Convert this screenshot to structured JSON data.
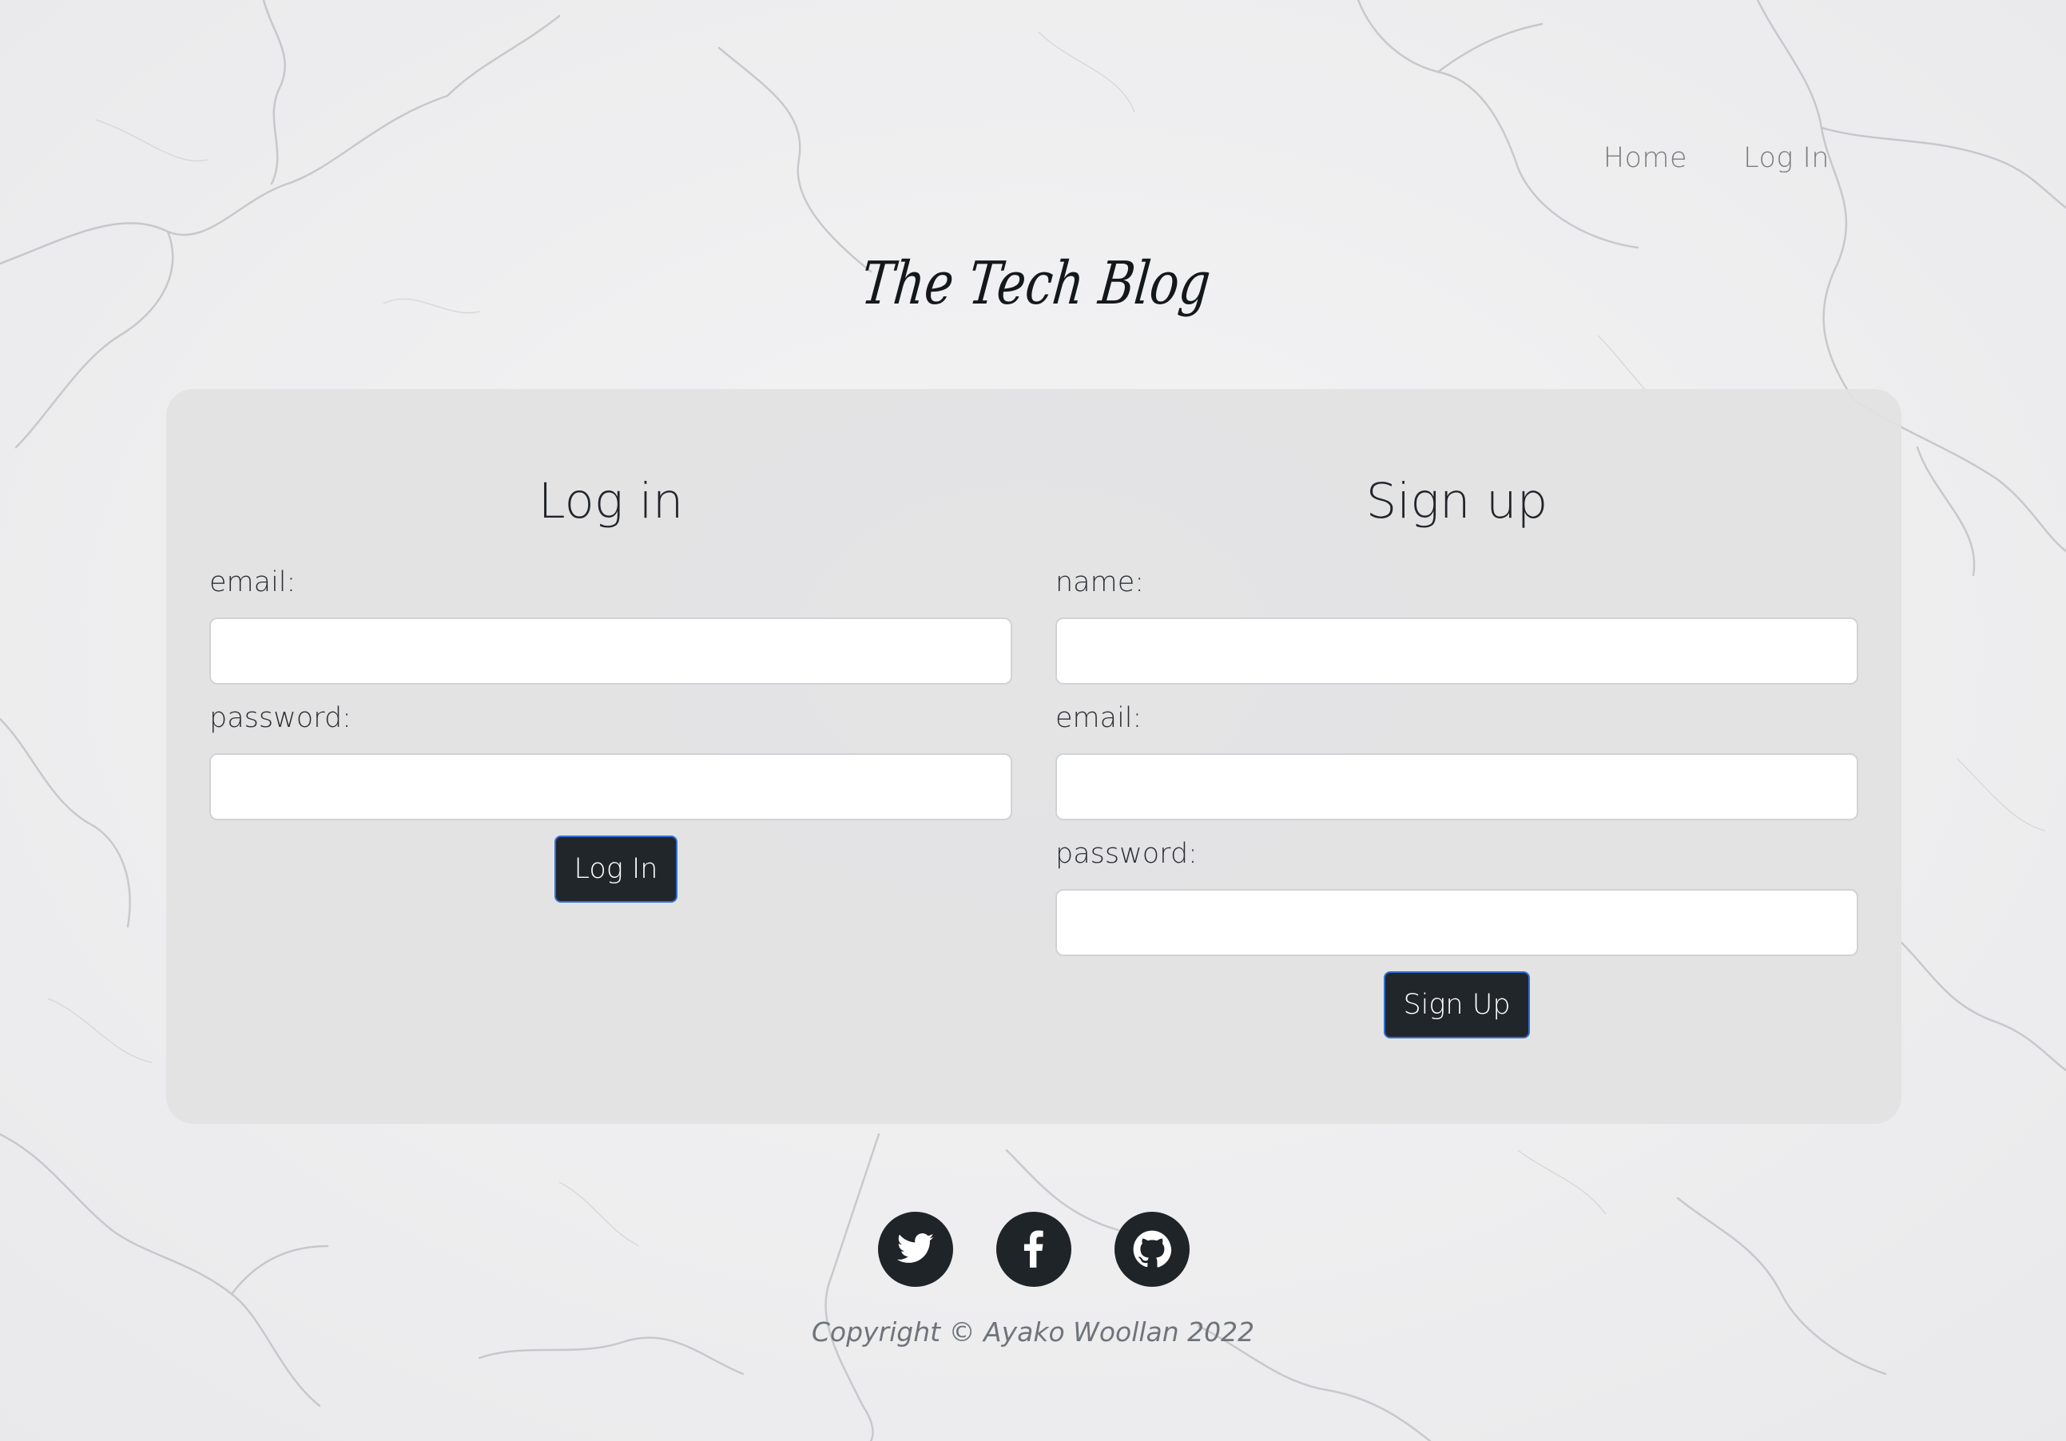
{
  "nav": {
    "home_label": "Home",
    "login_label": "Log In"
  },
  "brand": {
    "title": "The Tech Blog"
  },
  "login": {
    "heading": "Log in",
    "email_label": "email:",
    "email_value": "",
    "password_label": "password:",
    "password_value": "",
    "button_label": "Log In"
  },
  "signup": {
    "heading": "Sign up",
    "name_label": "name:",
    "name_value": "",
    "email_label": "email:",
    "email_value": "",
    "password_label": "password:",
    "password_value": "",
    "button_label": "Sign Up"
  },
  "footer": {
    "social_icons": [
      "twitter-icon",
      "facebook-icon",
      "github-icon"
    ],
    "copyright": "Copyright © Ayako Woollan 2022"
  },
  "colors": {
    "button_bg": "#21262b",
    "button_border": "#2f6ed8",
    "card_bg": "#e2e2e3",
    "social_bg": "#1f2429"
  }
}
